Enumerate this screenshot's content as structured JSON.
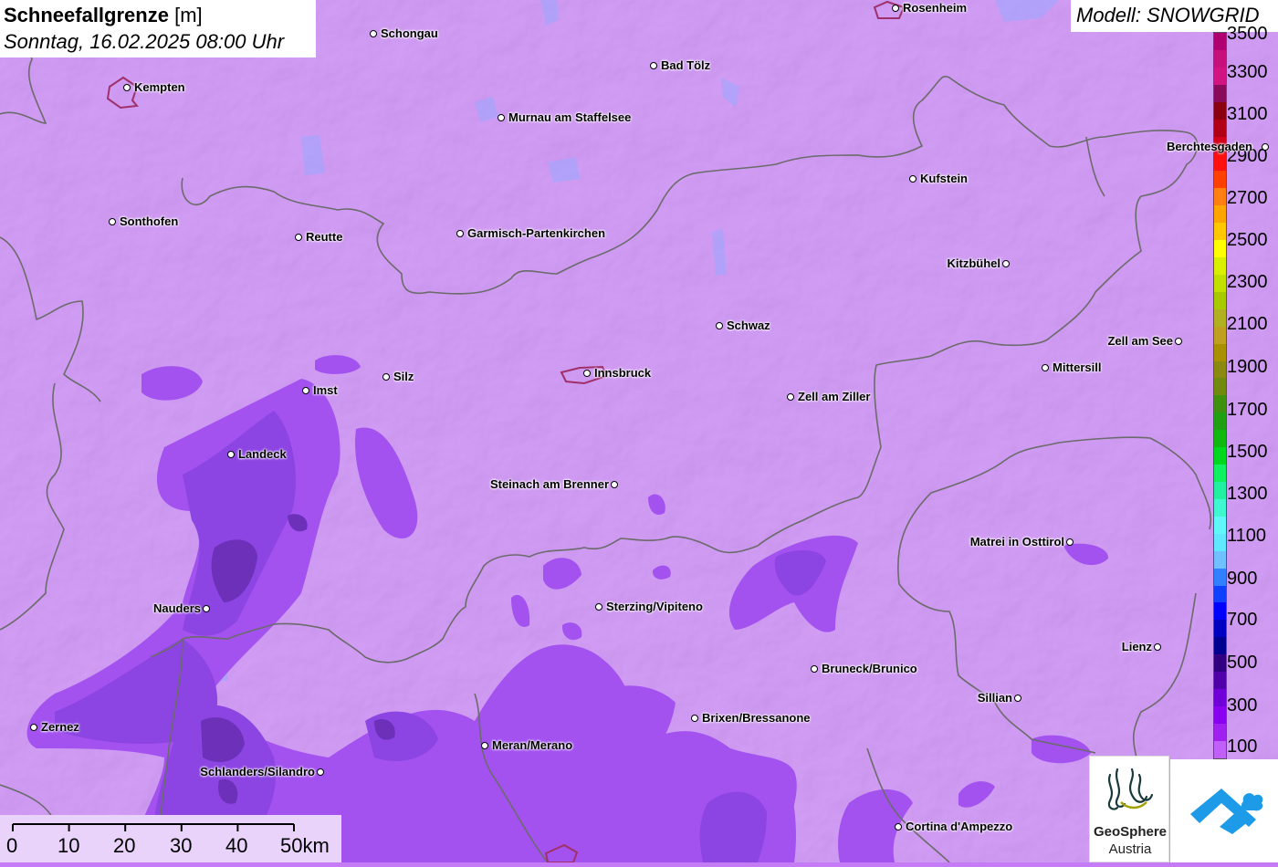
{
  "header": {
    "title": "Schneefallgrenze",
    "unit": "[m]",
    "datetime": "Sonntag, 16.02.2025 08:00 Uhr"
  },
  "model_label": "Modell: SNOWGRID",
  "legend": {
    "labels": [
      "3500",
      "3300",
      "3100",
      "2900",
      "2700",
      "2500",
      "2300",
      "2100",
      "1900",
      "1700",
      "1500",
      "1300",
      "1100",
      "900",
      "700",
      "500",
      "300",
      "100"
    ],
    "colors": [
      "#b0006f",
      "#c8107a",
      "#d21483",
      "#8a0a5a",
      "#8b0010",
      "#b10015",
      "#d2001a",
      "#ff1010",
      "#ff4000",
      "#ff8010",
      "#ffa500",
      "#ffc800",
      "#ffff00",
      "#d8f000",
      "#c0e000",
      "#a8c800",
      "#b0b020",
      "#c0a020",
      "#a89000",
      "#8a8a10",
      "#708a10",
      "#409010",
      "#20a010",
      "#10b810",
      "#00d820",
      "#10f060",
      "#20f0a0",
      "#40f8d0",
      "#60f8f8",
      "#60e8ff",
      "#70c0ff",
      "#3080ff",
      "#1040ff",
      "#0000ff",
      "#0000c0",
      "#000090",
      "#300080",
      "#5000a8",
      "#7000d8",
      "#8a00f0",
      "#a020f0",
      "#c060f8"
    ],
    "scale_color_top": "#b0006f",
    "scale_color_bottom": "#c060f8"
  },
  "cities": [
    {
      "name": "Rosenheim",
      "label_side": "right"
    },
    {
      "name": "Schongau",
      "label_side": "right"
    },
    {
      "name": "Kempten",
      "label_side": "right"
    },
    {
      "name": "Bad Tölz",
      "label_side": "right"
    },
    {
      "name": "Murnau am Staffelsee",
      "label_side": "right"
    },
    {
      "name": "Berchtesgaden",
      "label_side": "left"
    },
    {
      "name": "Kufstein",
      "label_side": "right"
    },
    {
      "name": "Sonthofen",
      "label_side": "right"
    },
    {
      "name": "Reutte",
      "label_side": "right"
    },
    {
      "name": "Garmisch-Partenkirchen",
      "label_side": "right"
    },
    {
      "name": "Kitzbühel",
      "label_side": "left"
    },
    {
      "name": "Schwaz",
      "label_side": "right"
    },
    {
      "name": "Zell am See",
      "label_side": "left"
    },
    {
      "name": "Mittersill",
      "label_side": "right"
    },
    {
      "name": "Silz",
      "label_side": "right"
    },
    {
      "name": "Innsbruck",
      "label_side": "right"
    },
    {
      "name": "Imst",
      "label_side": "right"
    },
    {
      "name": "Zell am Ziller",
      "label_side": "right"
    },
    {
      "name": "Landeck",
      "label_side": "right"
    },
    {
      "name": "Steinach am Brenner",
      "label_side": "left"
    },
    {
      "name": "Matrei in Osttirol",
      "label_side": "left"
    },
    {
      "name": "Nauders",
      "label_side": "left"
    },
    {
      "name": "Sterzing/Vipiteno",
      "label_side": "right"
    },
    {
      "name": "Lienz",
      "label_side": "left"
    },
    {
      "name": "Bruneck/Brunico",
      "label_side": "right"
    },
    {
      "name": "Sillian",
      "label_side": "left"
    },
    {
      "name": "Brixen/Bressanone",
      "label_side": "right"
    },
    {
      "name": "Zernez",
      "label_side": "right"
    },
    {
      "name": "Meran/Merano",
      "label_side": "right"
    },
    {
      "name": "Schlanders/Silandro",
      "label_side": "left"
    },
    {
      "name": "Cortina d'Ampezzo",
      "label_side": "right"
    }
  ],
  "scale_bar": {
    "labels": [
      "0",
      "10",
      "20",
      "30",
      "40",
      "50km"
    ]
  },
  "logos": {
    "geosphere_line1": "GeoSphere",
    "geosphere_line2": "Austria",
    "snowgrid_icon": "cloud-mountain-icon"
  },
  "colors": {
    "base_fill": "#c47bf5",
    "snow_low_fill": "#a24ff0",
    "snow_lower_fill": "#8a3fe0",
    "snow_lowest_fill": "#6a2cc0",
    "border_line": "#6b6b6b",
    "urban_outline": "#a0306a",
    "water": "#8ea8ff"
  }
}
